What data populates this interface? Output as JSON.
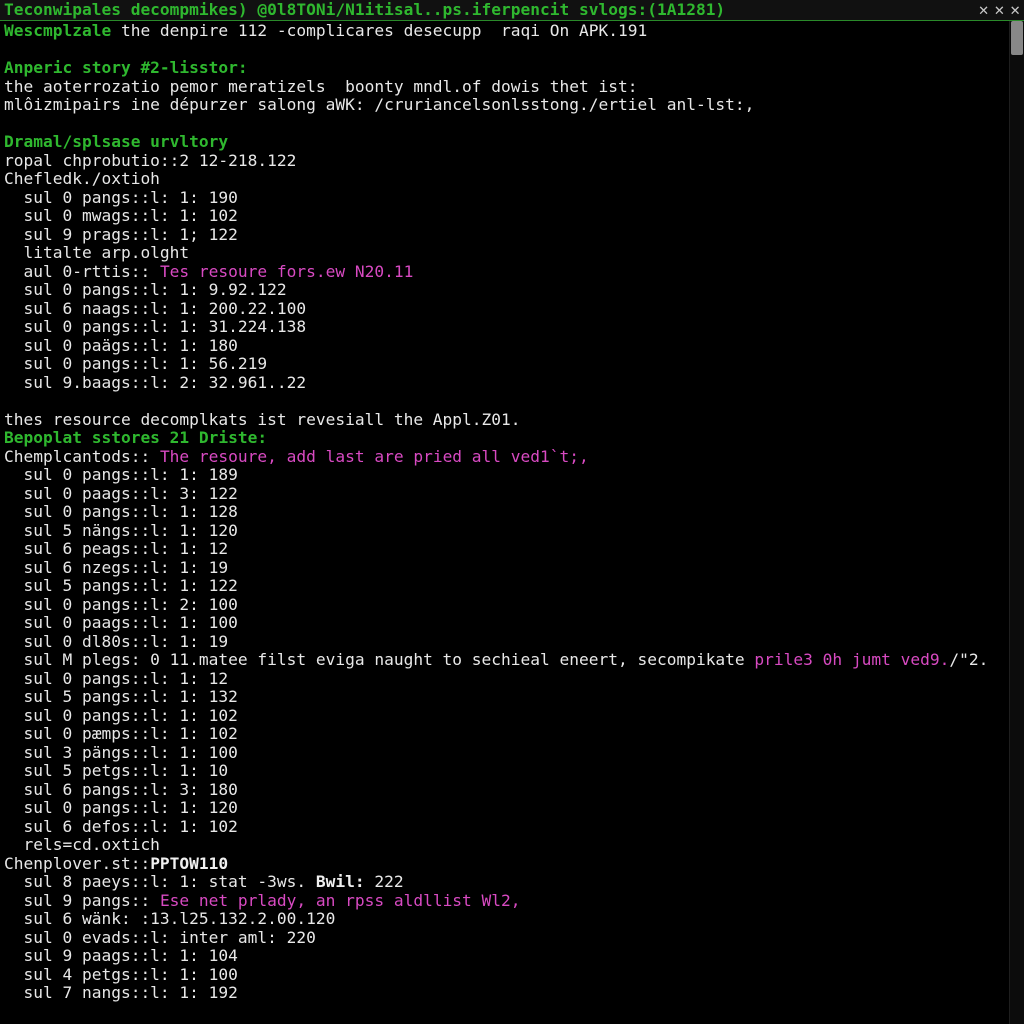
{
  "titlebar": {
    "title": "Teconwipales decompmikes) @0l8TONi/N1itisal..ps.iferpencit svlogs:(1A1281)",
    "close_label": "✕",
    "close2_label": "✕",
    "max_label": "✕"
  },
  "lines": [
    [
      {
        "c": "g",
        "t": "Wescmplzale"
      },
      {
        "c": "",
        "t": " the denpire 112 -complicares desecupp  raqi On APK.191"
      }
    ],
    [
      {
        "c": "",
        "t": " "
      }
    ],
    [
      {
        "c": "g",
        "t": "Anperic story #2-lisstor:"
      }
    ],
    [
      {
        "c": "",
        "t": "the aoterrozatio pemor meratizels  boonty mndl.of dowis thet ist:"
      }
    ],
    [
      {
        "c": "",
        "t": "mlôizmipairs ine dépurzer salong aWK: /cruriancelsonlsstong./ertiel anl-lst:,"
      }
    ],
    [
      {
        "c": "",
        "t": " "
      }
    ],
    [
      {
        "c": "g",
        "t": "Dramal/splsase urvltory"
      }
    ],
    [
      {
        "c": "",
        "t": "ropal chprobutio::2 12-218.122"
      }
    ],
    [
      {
        "c": "",
        "t": "Chefledk./oxtioh"
      }
    ],
    [
      {
        "c": "",
        "t": "  sul 0 pangs::l: 1: 190"
      }
    ],
    [
      {
        "c": "",
        "t": "  sul 0 mwags::l: 1: 102"
      }
    ],
    [
      {
        "c": "",
        "t": "  sul 9 prags::l: 1; 122"
      }
    ],
    [
      {
        "c": "",
        "t": "  litalte arp.olght"
      }
    ],
    [
      {
        "c": "",
        "t": "  aul 0-rttis:: "
      },
      {
        "c": "m",
        "t": "Tes resoure fors.ew N20.11"
      }
    ],
    [
      {
        "c": "",
        "t": "  sul 0 pangs::l: 1: 9.92.122"
      }
    ],
    [
      {
        "c": "",
        "t": "  sul 6 naags::l: 1: 200.22.100"
      }
    ],
    [
      {
        "c": "",
        "t": "  sul 0 pangs::l: 1: 31.224.138"
      }
    ],
    [
      {
        "c": "",
        "t": "  sul 0 paägs::l: 1: 180"
      }
    ],
    [
      {
        "c": "",
        "t": "  sul 0 pangs::l: 1: 56.219"
      }
    ],
    [
      {
        "c": "",
        "t": "  sul 9.baags::l: 2: 32.961..22"
      }
    ],
    [
      {
        "c": "",
        "t": " "
      }
    ],
    [
      {
        "c": "",
        "t": "thes resource decomplkats ist revesiall the Appl.Z01."
      }
    ],
    [
      {
        "c": "g",
        "t": "Bepoplat sstores 21 Driste:"
      }
    ],
    [
      {
        "c": "",
        "t": "Chemplcantods:: "
      },
      {
        "c": "m",
        "t": "The resoure, add last are pried all ved1`t;,"
      }
    ],
    [
      {
        "c": "",
        "t": "  sul 0 pangs::l: 1: 189"
      }
    ],
    [
      {
        "c": "",
        "t": "  sul 0 paags::l: 3: 122"
      }
    ],
    [
      {
        "c": "",
        "t": "  sul 0 pangs::l: 1: 128"
      }
    ],
    [
      {
        "c": "",
        "t": "  sul 5 nängs::l: 1: 120"
      }
    ],
    [
      {
        "c": "",
        "t": "  sul 6 peags::l: 1: 12"
      }
    ],
    [
      {
        "c": "",
        "t": "  sul 6 nzegs::l: 1: 19"
      }
    ],
    [
      {
        "c": "",
        "t": "  sul 5 pangs::l: 1: 122"
      }
    ],
    [
      {
        "c": "",
        "t": "  sul 0 pangs::l: 2: 100"
      }
    ],
    [
      {
        "c": "",
        "t": "  sul 0 paags::l: 1: 100"
      }
    ],
    [
      {
        "c": "",
        "t": "  sul 0 dl80s::l: 1: 19"
      }
    ],
    [
      {
        "c": "",
        "t": "  sul M plegs: 0 11.matee filst eviga naught to sechieal eneert, secompikate "
      },
      {
        "c": "m",
        "t": "prile3 0h jumt ved9."
      },
      {
        "c": "",
        "t": "/\"2."
      }
    ],
    [
      {
        "c": "",
        "t": "  sul 0 pangs::l: 1: 12"
      }
    ],
    [
      {
        "c": "",
        "t": "  sul 5 pangs::l: 1: 132"
      }
    ],
    [
      {
        "c": "",
        "t": "  sul 0 pangs::l: 1: 102"
      }
    ],
    [
      {
        "c": "",
        "t": "  sul 0 pæmps::l: 1: 102"
      }
    ],
    [
      {
        "c": "",
        "t": "  sul 3 pängs::l: 1: 100"
      }
    ],
    [
      {
        "c": "",
        "t": "  sul 5 petgs::l: 1: 10"
      }
    ],
    [
      {
        "c": "",
        "t": "  sul 6 pangs::l: 3: 180"
      }
    ],
    [
      {
        "c": "",
        "t": "  sul 0 pangs::l: 1: 120"
      }
    ],
    [
      {
        "c": "",
        "t": "  sul 6 defos::l: 1: 102"
      }
    ],
    [
      {
        "c": "",
        "t": "  rels=cd.oxtich"
      }
    ],
    [
      {
        "c": "",
        "t": "Chenplover.st::"
      },
      {
        "c": "bN",
        "t": "PPTOW110"
      }
    ],
    [
      {
        "c": "",
        "t": "  sul 8 paeys::l: 1: stat -3ws. "
      },
      {
        "c": "bN",
        "t": "Bwil:"
      },
      {
        "c": "",
        "t": " 222"
      }
    ],
    [
      {
        "c": "",
        "t": "  sul 9 pangs:: "
      },
      {
        "c": "m",
        "t": "Ese net prlady, an rpss aldllist Wl2,"
      }
    ],
    [
      {
        "c": "",
        "t": "  sul 6 wänk: :13.l25.132.2.00.120"
      }
    ],
    [
      {
        "c": "",
        "t": "  sul 0 evads::l: inter aml: 220"
      }
    ],
    [
      {
        "c": "",
        "t": "  sul 9 paags::l: 1: 104"
      }
    ],
    [
      {
        "c": "",
        "t": "  sul 4 petgs::l: 1: 100"
      }
    ],
    [
      {
        "c": "",
        "t": "  sul 7 nangs::l: 1: 192"
      }
    ]
  ]
}
